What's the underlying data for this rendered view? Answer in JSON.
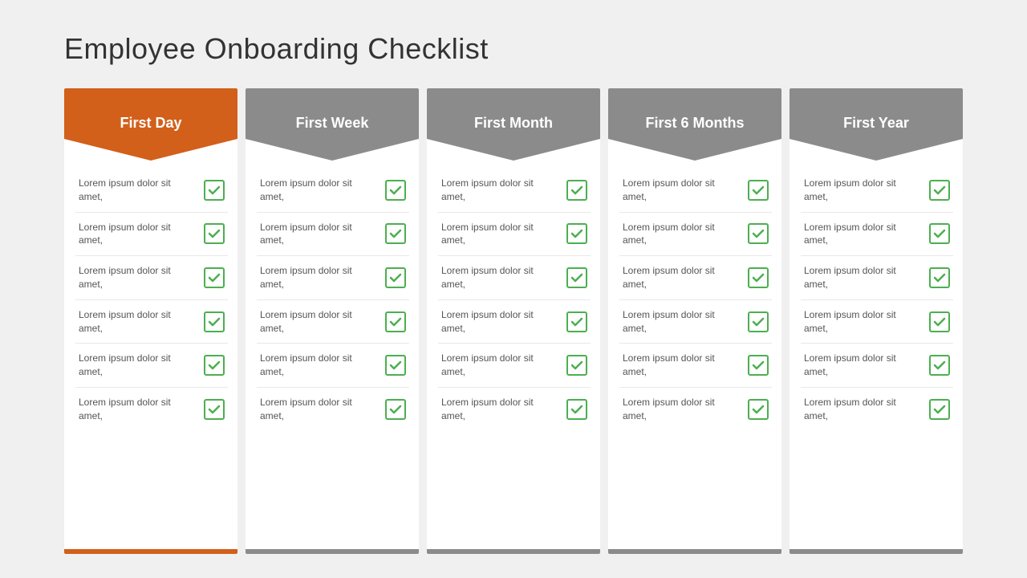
{
  "title": "Employee  Onboarding  Checklist",
  "columns": [
    {
      "id": "col-0",
      "header": "First Day",
      "color": "#d2601a",
      "items": [
        "Lorem ipsum dolor sit amet,",
        "Lorem ipsum dolor sit amet,",
        "Lorem ipsum dolor sit amet,",
        "Lorem ipsum dolor sit amet,",
        "Lorem ipsum dolor sit amet,",
        "Lorem ipsum dolor sit amet,"
      ]
    },
    {
      "id": "col-1",
      "header": "First Week",
      "color": "#8b8b8b",
      "items": [
        "Lorem ipsum dolor sit amet,",
        "Lorem ipsum dolor sit amet,",
        "Lorem ipsum dolor sit amet,",
        "Lorem ipsum dolor sit amet,",
        "Lorem ipsum dolor sit amet,",
        "Lorem ipsum dolor sit amet,"
      ]
    },
    {
      "id": "col-2",
      "header": "First Month",
      "color": "#8b8b8b",
      "items": [
        "Lorem ipsum dolor sit amet,",
        "Lorem ipsum dolor sit amet,",
        "Lorem ipsum dolor sit amet,",
        "Lorem ipsum dolor sit amet,",
        "Lorem ipsum dolor sit amet,",
        "Lorem ipsum dolor sit amet,"
      ]
    },
    {
      "id": "col-3",
      "header": "First 6 Months",
      "color": "#8b8b8b",
      "items": [
        "Lorem ipsum dolor sit amet,",
        "Lorem ipsum dolor sit amet,",
        "Lorem ipsum dolor sit amet,",
        "Lorem ipsum dolor sit amet,",
        "Lorem ipsum dolor sit amet,",
        "Lorem ipsum dolor sit amet,"
      ]
    },
    {
      "id": "col-4",
      "header": "First Year",
      "color": "#8b8b8b",
      "items": [
        "Lorem ipsum dolor sit amet,",
        "Lorem ipsum dolor sit amet,",
        "Lorem ipsum dolor sit amet,",
        "Lorem ipsum dolor sit amet,",
        "Lorem ipsum dolor sit amet,",
        "Lorem ipsum dolor sit amet,"
      ]
    }
  ],
  "checkmark_color": "#4caf50"
}
